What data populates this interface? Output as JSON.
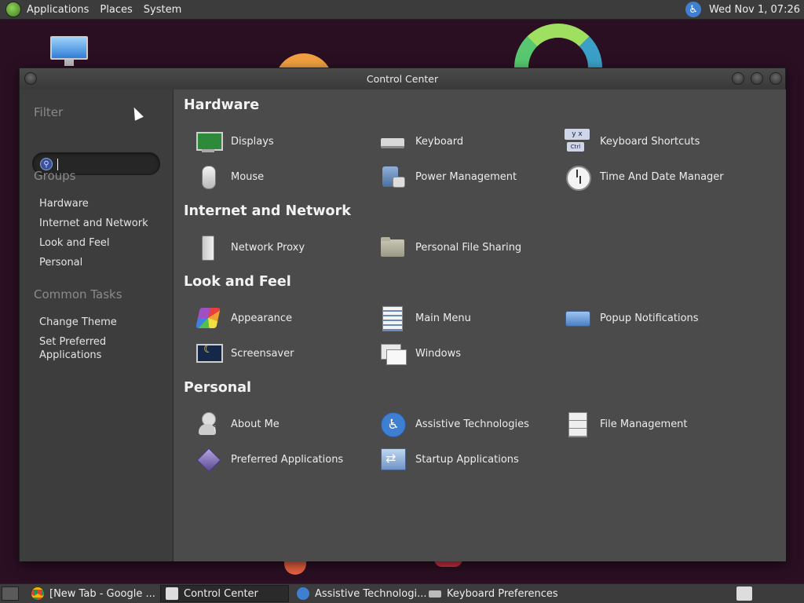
{
  "top_panel": {
    "menus": [
      "Applications",
      "Places",
      "System"
    ],
    "clock": "Wed Nov 1, 07:26"
  },
  "window": {
    "title": "Control Center"
  },
  "sidebar": {
    "filter_heading": "Filter",
    "search_value": "",
    "groups_heading": "Groups",
    "groups": [
      "Hardware",
      "Internet and Network",
      "Look and Feel",
      "Personal"
    ],
    "tasks_heading": "Common Tasks",
    "tasks": [
      "Change Theme",
      "Set Preferred Applications"
    ]
  },
  "sections": [
    {
      "title": "Hardware",
      "items": [
        {
          "label": "Displays",
          "icon": "display-icon"
        },
        {
          "label": "Keyboard",
          "icon": "keyboard-icon"
        },
        {
          "label": "Keyboard Shortcuts",
          "icon": "keyboard-shortcuts-icon"
        },
        {
          "label": "Mouse",
          "icon": "mouse-icon"
        },
        {
          "label": "Power Management",
          "icon": "power-management-icon"
        },
        {
          "label": "Time And Date Manager",
          "icon": "clock-icon"
        }
      ]
    },
    {
      "title": "Internet and Network",
      "items": [
        {
          "label": "Network Proxy",
          "icon": "network-proxy-icon"
        },
        {
          "label": "Personal File Sharing",
          "icon": "folder-share-icon"
        }
      ]
    },
    {
      "title": "Look and Feel",
      "items": [
        {
          "label": "Appearance",
          "icon": "appearance-icon"
        },
        {
          "label": "Main Menu",
          "icon": "main-menu-icon"
        },
        {
          "label": "Popup Notifications",
          "icon": "popup-notification-icon"
        },
        {
          "label": "Screensaver",
          "icon": "screensaver-icon"
        },
        {
          "label": "Windows",
          "icon": "windows-icon"
        }
      ]
    },
    {
      "title": "Personal",
      "items": [
        {
          "label": "About Me",
          "icon": "about-me-icon"
        },
        {
          "label": "Assistive Technologies",
          "icon": "accessibility-icon"
        },
        {
          "label": "File Management",
          "icon": "file-cabinet-icon"
        },
        {
          "label": "Preferred Applications",
          "icon": "preferred-apps-icon"
        },
        {
          "label": "Startup Applications",
          "icon": "startup-apps-icon"
        }
      ]
    }
  ],
  "taskbar": {
    "tasks": [
      {
        "label": "[New Tab - Google ...",
        "icon": "chrome-icon",
        "active": false
      },
      {
        "label": "Control Center",
        "icon": "control-center-icon",
        "active": true
      },
      {
        "label": "Assistive Technologi...",
        "icon": "accessibility-icon",
        "active": false
      },
      {
        "label": "Keyboard Preferences",
        "icon": "keyboard-icon",
        "active": false
      }
    ]
  },
  "colors": {
    "panel": "#3c3c3c",
    "window_bg": "#3b3b3b",
    "content_bg": "#4b4b4b",
    "accent_blue": "#3f7fd1"
  }
}
